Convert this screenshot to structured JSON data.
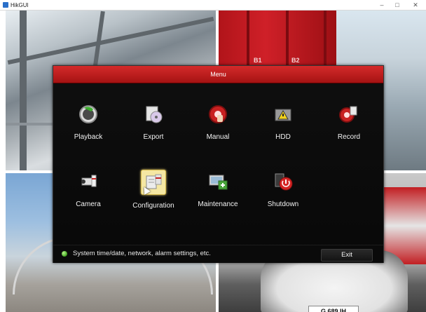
{
  "window": {
    "title": "HikGUI",
    "controls": {
      "minimize": "–",
      "maximize": "□",
      "close": "✕"
    }
  },
  "cameras": {
    "cam2_labels": [
      "B1",
      "B2"
    ],
    "cam4_plate": "G 689 IH"
  },
  "menu": {
    "title": "Menu",
    "items": [
      {
        "label": "Playback",
        "icon": "playback-icon"
      },
      {
        "label": "Export",
        "icon": "export-icon"
      },
      {
        "label": "Manual",
        "icon": "manual-record-icon"
      },
      {
        "label": "HDD",
        "icon": "hdd-icon"
      },
      {
        "label": "Record",
        "icon": "record-icon"
      },
      {
        "label": "Camera",
        "icon": "camera-icon"
      },
      {
        "label": "Configuration",
        "icon": "configuration-icon",
        "selected": true
      },
      {
        "label": "Maintenance",
        "icon": "maintenance-icon"
      },
      {
        "label": "Shutdown",
        "icon": "shutdown-icon"
      }
    ],
    "status_text": "System time/date, network, alarm settings, etc.",
    "exit_label": "Exit"
  },
  "colors": {
    "title_red": "#c41f1f",
    "dialog_bg": "#0b0b0b",
    "status_green": "#3fa21e"
  }
}
